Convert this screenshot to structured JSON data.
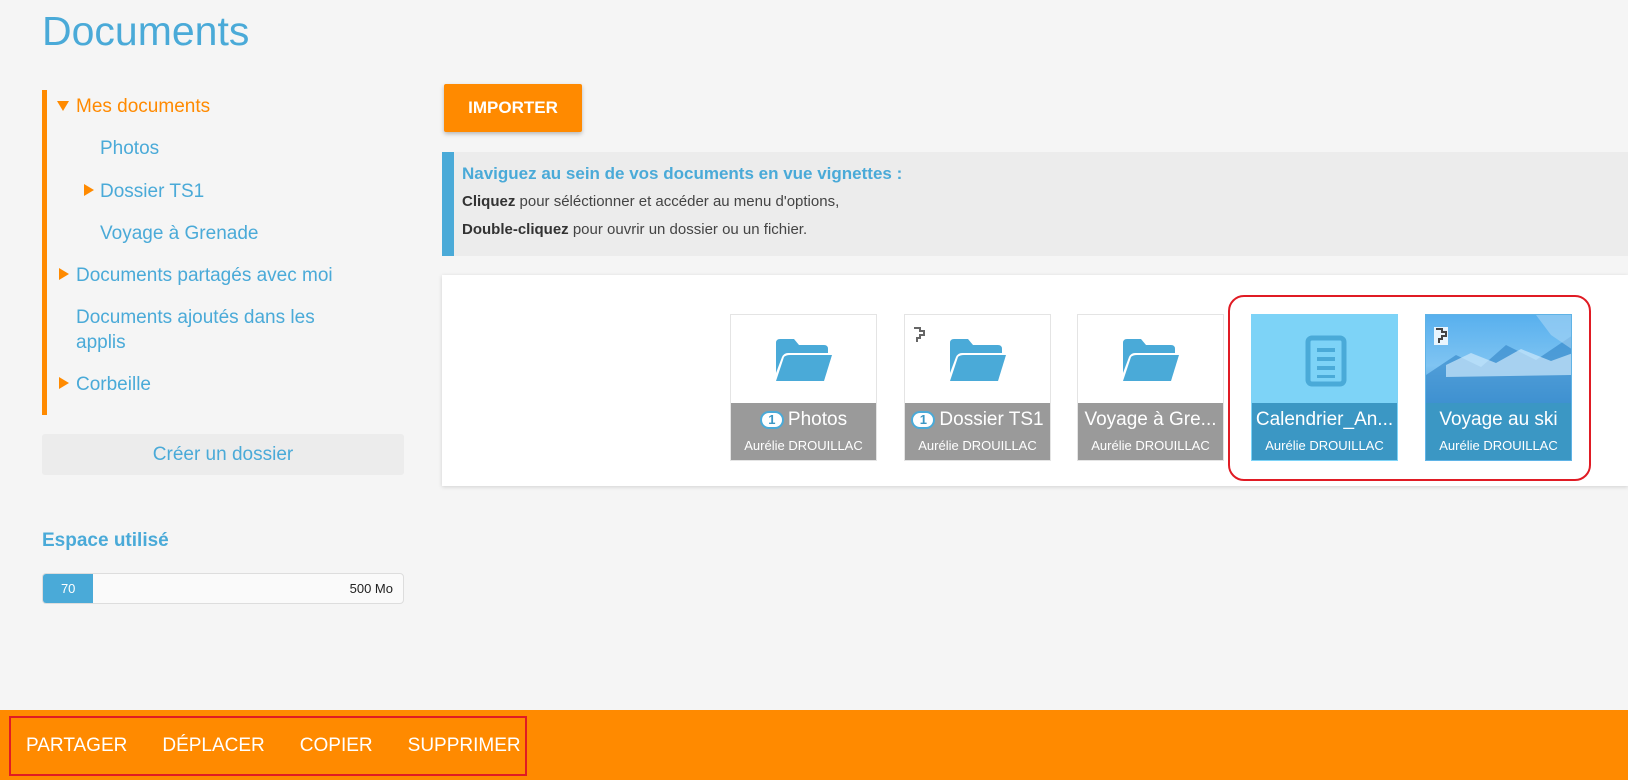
{
  "page": {
    "title": "Documents"
  },
  "tree": {
    "items": [
      {
        "label": "Mes documents"
      },
      {
        "label": "Photos"
      },
      {
        "label": "Dossier TS1"
      },
      {
        "label": "Voyage à Grenade"
      },
      {
        "label": "Documents partagés avec moi"
      },
      {
        "label": "Documents ajoutés dans les applis"
      },
      {
        "label": "Corbeille"
      }
    ],
    "create_folder": "Créer un dossier"
  },
  "storage": {
    "title": "Espace utilisé",
    "used": "70",
    "total": "500 Mo",
    "used_fraction": 0.14
  },
  "toolbar": {
    "import_label": "IMPORTER"
  },
  "info": {
    "title": "Naviguez au sein de vos documents en vue vignettes :",
    "line1_bold": "Cliquez",
    "line1_text": " pour séléctionner et accéder au menu d'options,",
    "line2_bold": "Double-cliquez",
    "line2_text": " pour ouvrir un dossier ou un fichier."
  },
  "tiles": [
    {
      "name": "Photos",
      "owner": "Aurélie DROUILLAC",
      "count": "1",
      "icon": "folder-icon",
      "shared": false,
      "selected": false
    },
    {
      "name": "Dossier TS1",
      "owner": "Aurélie DROUILLAC",
      "count": "1",
      "icon": "folder-icon",
      "shared": true,
      "selected": false
    },
    {
      "name": "Voyage à Gre...",
      "owner": "Aurélie DROUILLAC",
      "icon": "folder-icon",
      "shared": false,
      "selected": false
    },
    {
      "name": "Calendrier_An...",
      "owner": "Aurélie DROUILLAC",
      "icon": "document-icon",
      "shared": false,
      "selected": true
    },
    {
      "name": "Voyage au ski",
      "owner": "Aurélie DROUILLAC",
      "icon": "image-thumbnail",
      "shared": true,
      "selected": true
    }
  ],
  "actions": [
    {
      "label": "PARTAGER"
    },
    {
      "label": "DÉPLACER"
    },
    {
      "label": "COPIER"
    },
    {
      "label": "SUPPRIMER"
    }
  ],
  "colors": {
    "accent": "#ff8a00",
    "primary": "#4aaad8",
    "selected": "#3b97c4",
    "highlight": "#e01b24"
  }
}
